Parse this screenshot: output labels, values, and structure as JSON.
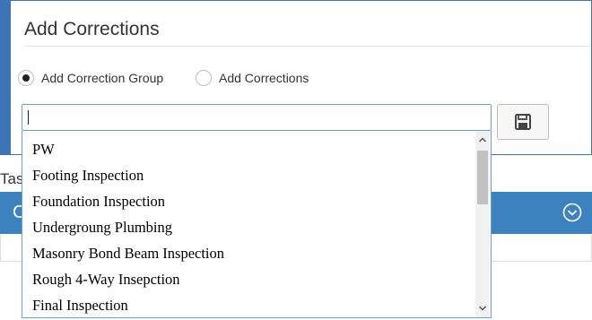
{
  "panel": {
    "title": "Add Corrections",
    "radios": [
      {
        "label": "Add Correction Group",
        "checked": true
      },
      {
        "label": "Add Corrections",
        "checked": false
      }
    ],
    "search": {
      "value": "",
      "placeholder": ""
    },
    "save_icon": "floppy-disk-icon"
  },
  "background": {
    "partial_label": "Tas",
    "bar_char": "C",
    "bar_icon": "chevron-circle-down-icon",
    "bar_color": "#3b82bf"
  },
  "dropdown": {
    "options": [
      "PW",
      "Footing Inspection",
      "Foundation Inspection",
      "Undergroung Plumbing",
      "Masonry Bond Beam Inspection",
      "Rough 4-Way Insepction",
      "Final Inspection"
    ]
  }
}
